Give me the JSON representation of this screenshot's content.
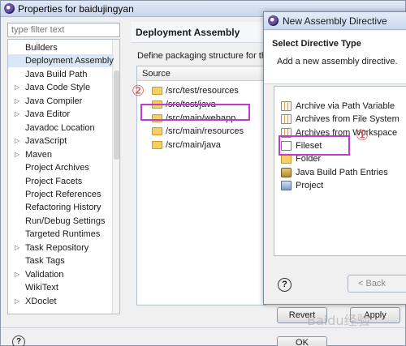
{
  "window": {
    "title": "Properties for baidujingyan",
    "filter_placeholder": "type filter text",
    "help_icon": "?",
    "buttons": {
      "restore": "Revert",
      "apply": "Apply",
      "ok": "OK"
    }
  },
  "nav_tree": [
    {
      "label": "Builders",
      "expandable": false,
      "selected": false
    },
    {
      "label": "Deployment Assembly",
      "expandable": false,
      "selected": true
    },
    {
      "label": "Java Build Path",
      "expandable": false,
      "selected": false
    },
    {
      "label": "Java Code Style",
      "expandable": true,
      "selected": false
    },
    {
      "label": "Java Compiler",
      "expandable": true,
      "selected": false
    },
    {
      "label": "Java Editor",
      "expandable": true,
      "selected": false
    },
    {
      "label": "Javadoc Location",
      "expandable": false,
      "selected": false
    },
    {
      "label": "JavaScript",
      "expandable": true,
      "selected": false
    },
    {
      "label": "Maven",
      "expandable": true,
      "selected": false
    },
    {
      "label": "Project Archives",
      "expandable": false,
      "selected": false
    },
    {
      "label": "Project Facets",
      "expandable": false,
      "selected": false
    },
    {
      "label": "Project References",
      "expandable": false,
      "selected": false
    },
    {
      "label": "Refactoring History",
      "expandable": false,
      "selected": false
    },
    {
      "label": "Run/Debug Settings",
      "expandable": false,
      "selected": false
    },
    {
      "label": "Targeted Runtimes",
      "expandable": false,
      "selected": false
    },
    {
      "label": "Task Repository",
      "expandable": true,
      "selected": false
    },
    {
      "label": "Task Tags",
      "expandable": false,
      "selected": false
    },
    {
      "label": "Validation",
      "expandable": true,
      "selected": false
    },
    {
      "label": "WikiText",
      "expandable": false,
      "selected": false
    },
    {
      "label": "XDoclet",
      "expandable": true,
      "selected": false
    }
  ],
  "deployment": {
    "title": "Deployment Assembly",
    "description": "Define packaging structure for th",
    "column_header": "Source",
    "rows": [
      "/src/test/resources",
      "/src/test/java",
      "/src/main/webapp",
      "/src/main/resources",
      "/src/main/java"
    ],
    "highlighted_row": "/src/main/webapp"
  },
  "dialog": {
    "title": "New Assembly Directive",
    "header_title": "Select Directive Type",
    "header_desc": "Add a new assembly directive.",
    "items": [
      {
        "label": "Archive via Path Variable",
        "icon": "archive-icon"
      },
      {
        "label": "Archives from File System",
        "icon": "archive-icon"
      },
      {
        "label": "Archives from Workspace",
        "icon": "archive-icon"
      },
      {
        "label": "Fileset",
        "icon": "file-icon"
      },
      {
        "label": "Folder",
        "icon": "folder-icon"
      },
      {
        "label": "Java Build Path Entries",
        "icon": "jar-icon"
      },
      {
        "label": "Project",
        "icon": "project-icon"
      }
    ],
    "highlighted_item": "Folder",
    "help_icon": "?",
    "back_button": "< Back"
  },
  "annotations": {
    "marker_1": "①",
    "marker_2": "②",
    "highlight_color": "#c03ad0",
    "marker_color": "#d9534f"
  },
  "watermark": "Baidu经验"
}
